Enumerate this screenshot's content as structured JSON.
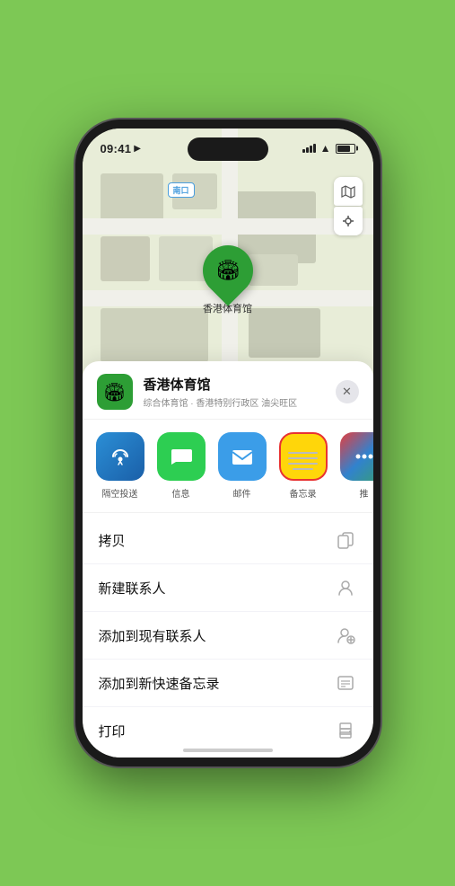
{
  "status": {
    "time": "09:41",
    "location_arrow": "▶"
  },
  "map": {
    "label": "南口",
    "pin_label": "香港体育馆",
    "pin_emoji": "🏟"
  },
  "venue": {
    "name": "香港体育馆",
    "subtitle": "综合体育馆 · 香港特别行政区 油尖旺区",
    "icon_emoji": "🏟"
  },
  "share_items": [
    {
      "id": "airdrop",
      "label": "隔空投送"
    },
    {
      "id": "message",
      "label": "信息"
    },
    {
      "id": "mail",
      "label": "邮件"
    },
    {
      "id": "notes",
      "label": "备忘录"
    },
    {
      "id": "more",
      "label": "推"
    }
  ],
  "actions": [
    {
      "label": "拷贝",
      "icon": "copy"
    },
    {
      "label": "新建联系人",
      "icon": "person"
    },
    {
      "label": "添加到现有联系人",
      "icon": "person-add"
    },
    {
      "label": "添加到新快速备忘录",
      "icon": "note"
    },
    {
      "label": "打印",
      "icon": "printer"
    }
  ],
  "close_label": "✕"
}
